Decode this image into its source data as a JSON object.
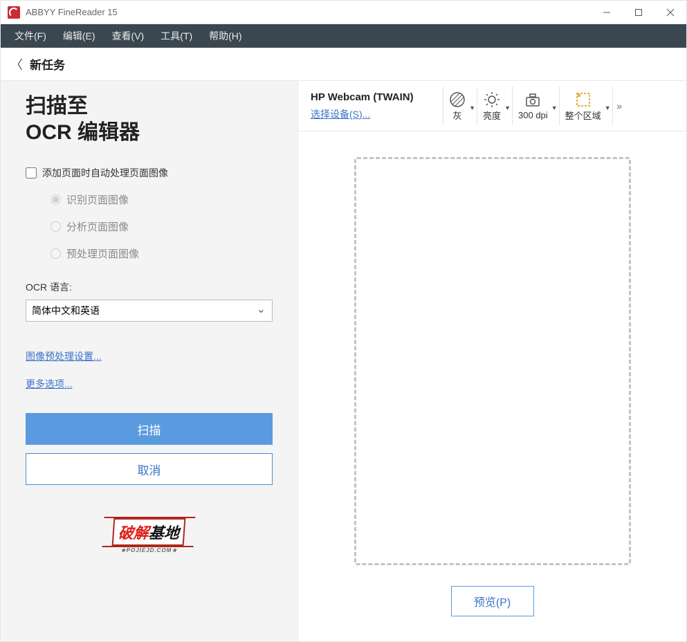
{
  "titlebar": {
    "app_name": "ABBYY FineReader 15"
  },
  "menu": {
    "file": "文件(F)",
    "edit": "编辑(E)",
    "view": "查看(V)",
    "tools": "工具(T)",
    "help": "帮助(H)"
  },
  "task": {
    "label": "新任务"
  },
  "heading": {
    "line1": "扫描至",
    "line2": "OCR 编辑器"
  },
  "checkbox": {
    "auto_process": "添加页面时自动处理页面图像"
  },
  "radios": {
    "recognize": "识别页面图像",
    "analyze": "分析页面图像",
    "preprocess": "预处理页面图像"
  },
  "ocr_lang": {
    "label": "OCR 语言:",
    "value": "简体中文和英语"
  },
  "links": {
    "preprocess": "图像预处理设置...",
    "more": "更多选项..."
  },
  "buttons": {
    "scan": "扫描",
    "cancel": "取消",
    "preview": "预览(P)"
  },
  "stamp": {
    "a": "破解",
    "b": "基地",
    "sub": "★POJIEJD.COM★"
  },
  "device": {
    "name": "HP Webcam (TWAIN)",
    "select": "选择设备(S)..."
  },
  "tools": {
    "gray": "灰",
    "brightness": "亮度",
    "dpi": "300 dpi",
    "region": "整个区域"
  }
}
